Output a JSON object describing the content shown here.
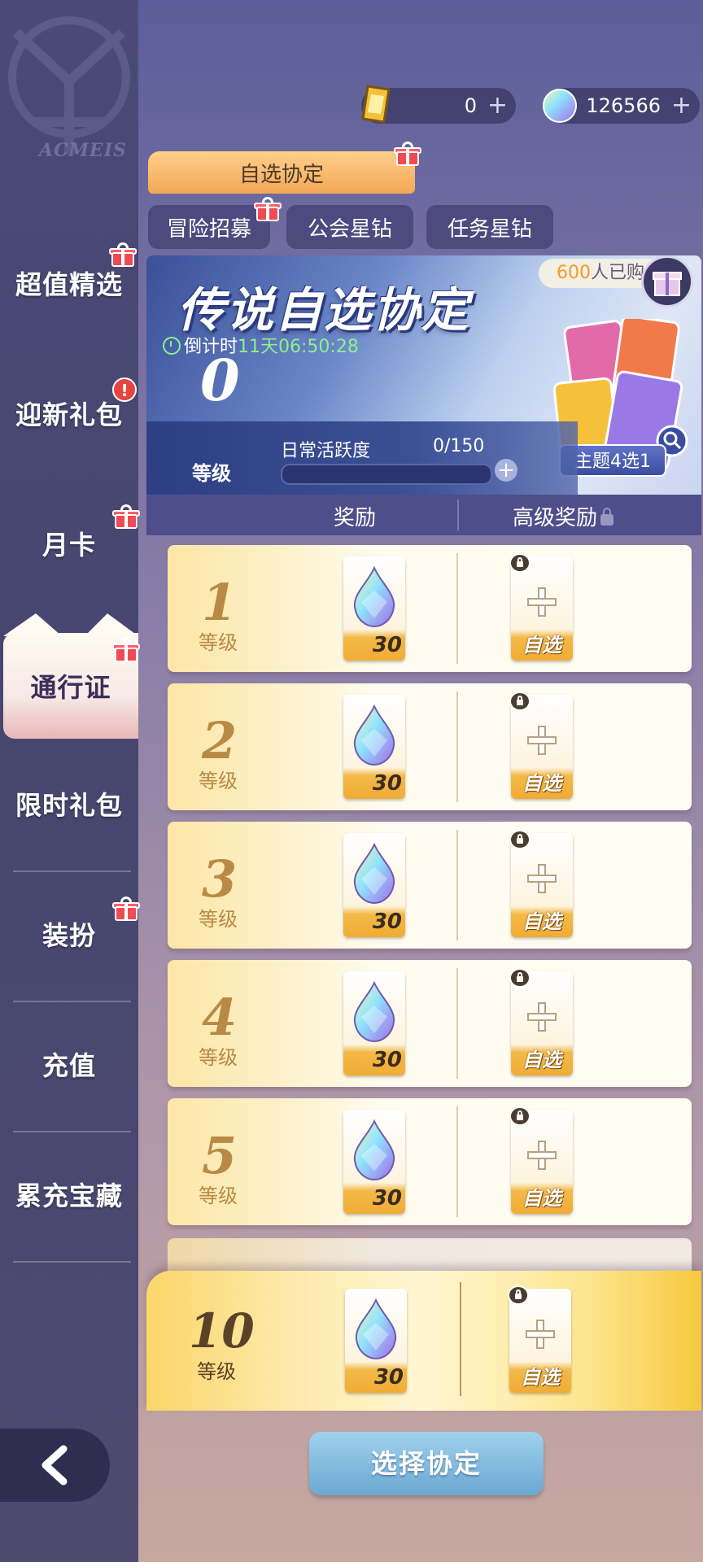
{
  "sidebar": {
    "logo_text": "ACMEIS",
    "items": [
      {
        "label": "超值精选"
      },
      {
        "label": "迎新礼包",
        "alert": "!"
      },
      {
        "label": "月卡"
      },
      {
        "label": "通行证"
      },
      {
        "label": "限时礼包"
      },
      {
        "label": "装扮"
      },
      {
        "label": "充值"
      },
      {
        "label": "累充宝藏"
      }
    ],
    "active": "通行证"
  },
  "currencies": [
    {
      "icon": "gold-ticket-icon",
      "value": "0",
      "plus": "+"
    },
    {
      "icon": "star-diamond-icon",
      "value": "126566",
      "plus": "+"
    }
  ],
  "tabs": {
    "main": "自选协定",
    "sub": [
      "冒险招募",
      "公会星钻",
      "任务星钻"
    ]
  },
  "banner": {
    "title": "传说自选协定",
    "countdown_label": "倒计时",
    "countdown_time": "11天06:50:28",
    "bought_count": "600",
    "bought_suffix": "人已购",
    "level_value": "0",
    "level_label": "等级",
    "activity_label": "日常活跃度",
    "activity_value": "0/150",
    "activity_progress": 0,
    "theme_button": "主题4选1"
  },
  "reward_header": {
    "col1": "奖励",
    "col2": "高级奖励"
  },
  "levels": [
    {
      "level": "1",
      "label": "等级",
      "reward_count": "30",
      "premium_label": "自选"
    },
    {
      "level": "2",
      "label": "等级",
      "reward_count": "30",
      "premium_label": "自选"
    },
    {
      "level": "3",
      "label": "等级",
      "reward_count": "30",
      "premium_label": "自选"
    },
    {
      "level": "4",
      "label": "等级",
      "reward_count": "30",
      "premium_label": "自选"
    },
    {
      "level": "5",
      "label": "等级",
      "reward_count": "30",
      "premium_label": "自选"
    }
  ],
  "final_level": {
    "level": "10",
    "label": "等级",
    "reward_count": "30",
    "premium_label": "自选"
  },
  "select_button": "选择协定",
  "colors": {
    "accent_orange": "#f3a857",
    "countdown_green": "#8ef08a",
    "button_blue": "#6aa8d2"
  }
}
